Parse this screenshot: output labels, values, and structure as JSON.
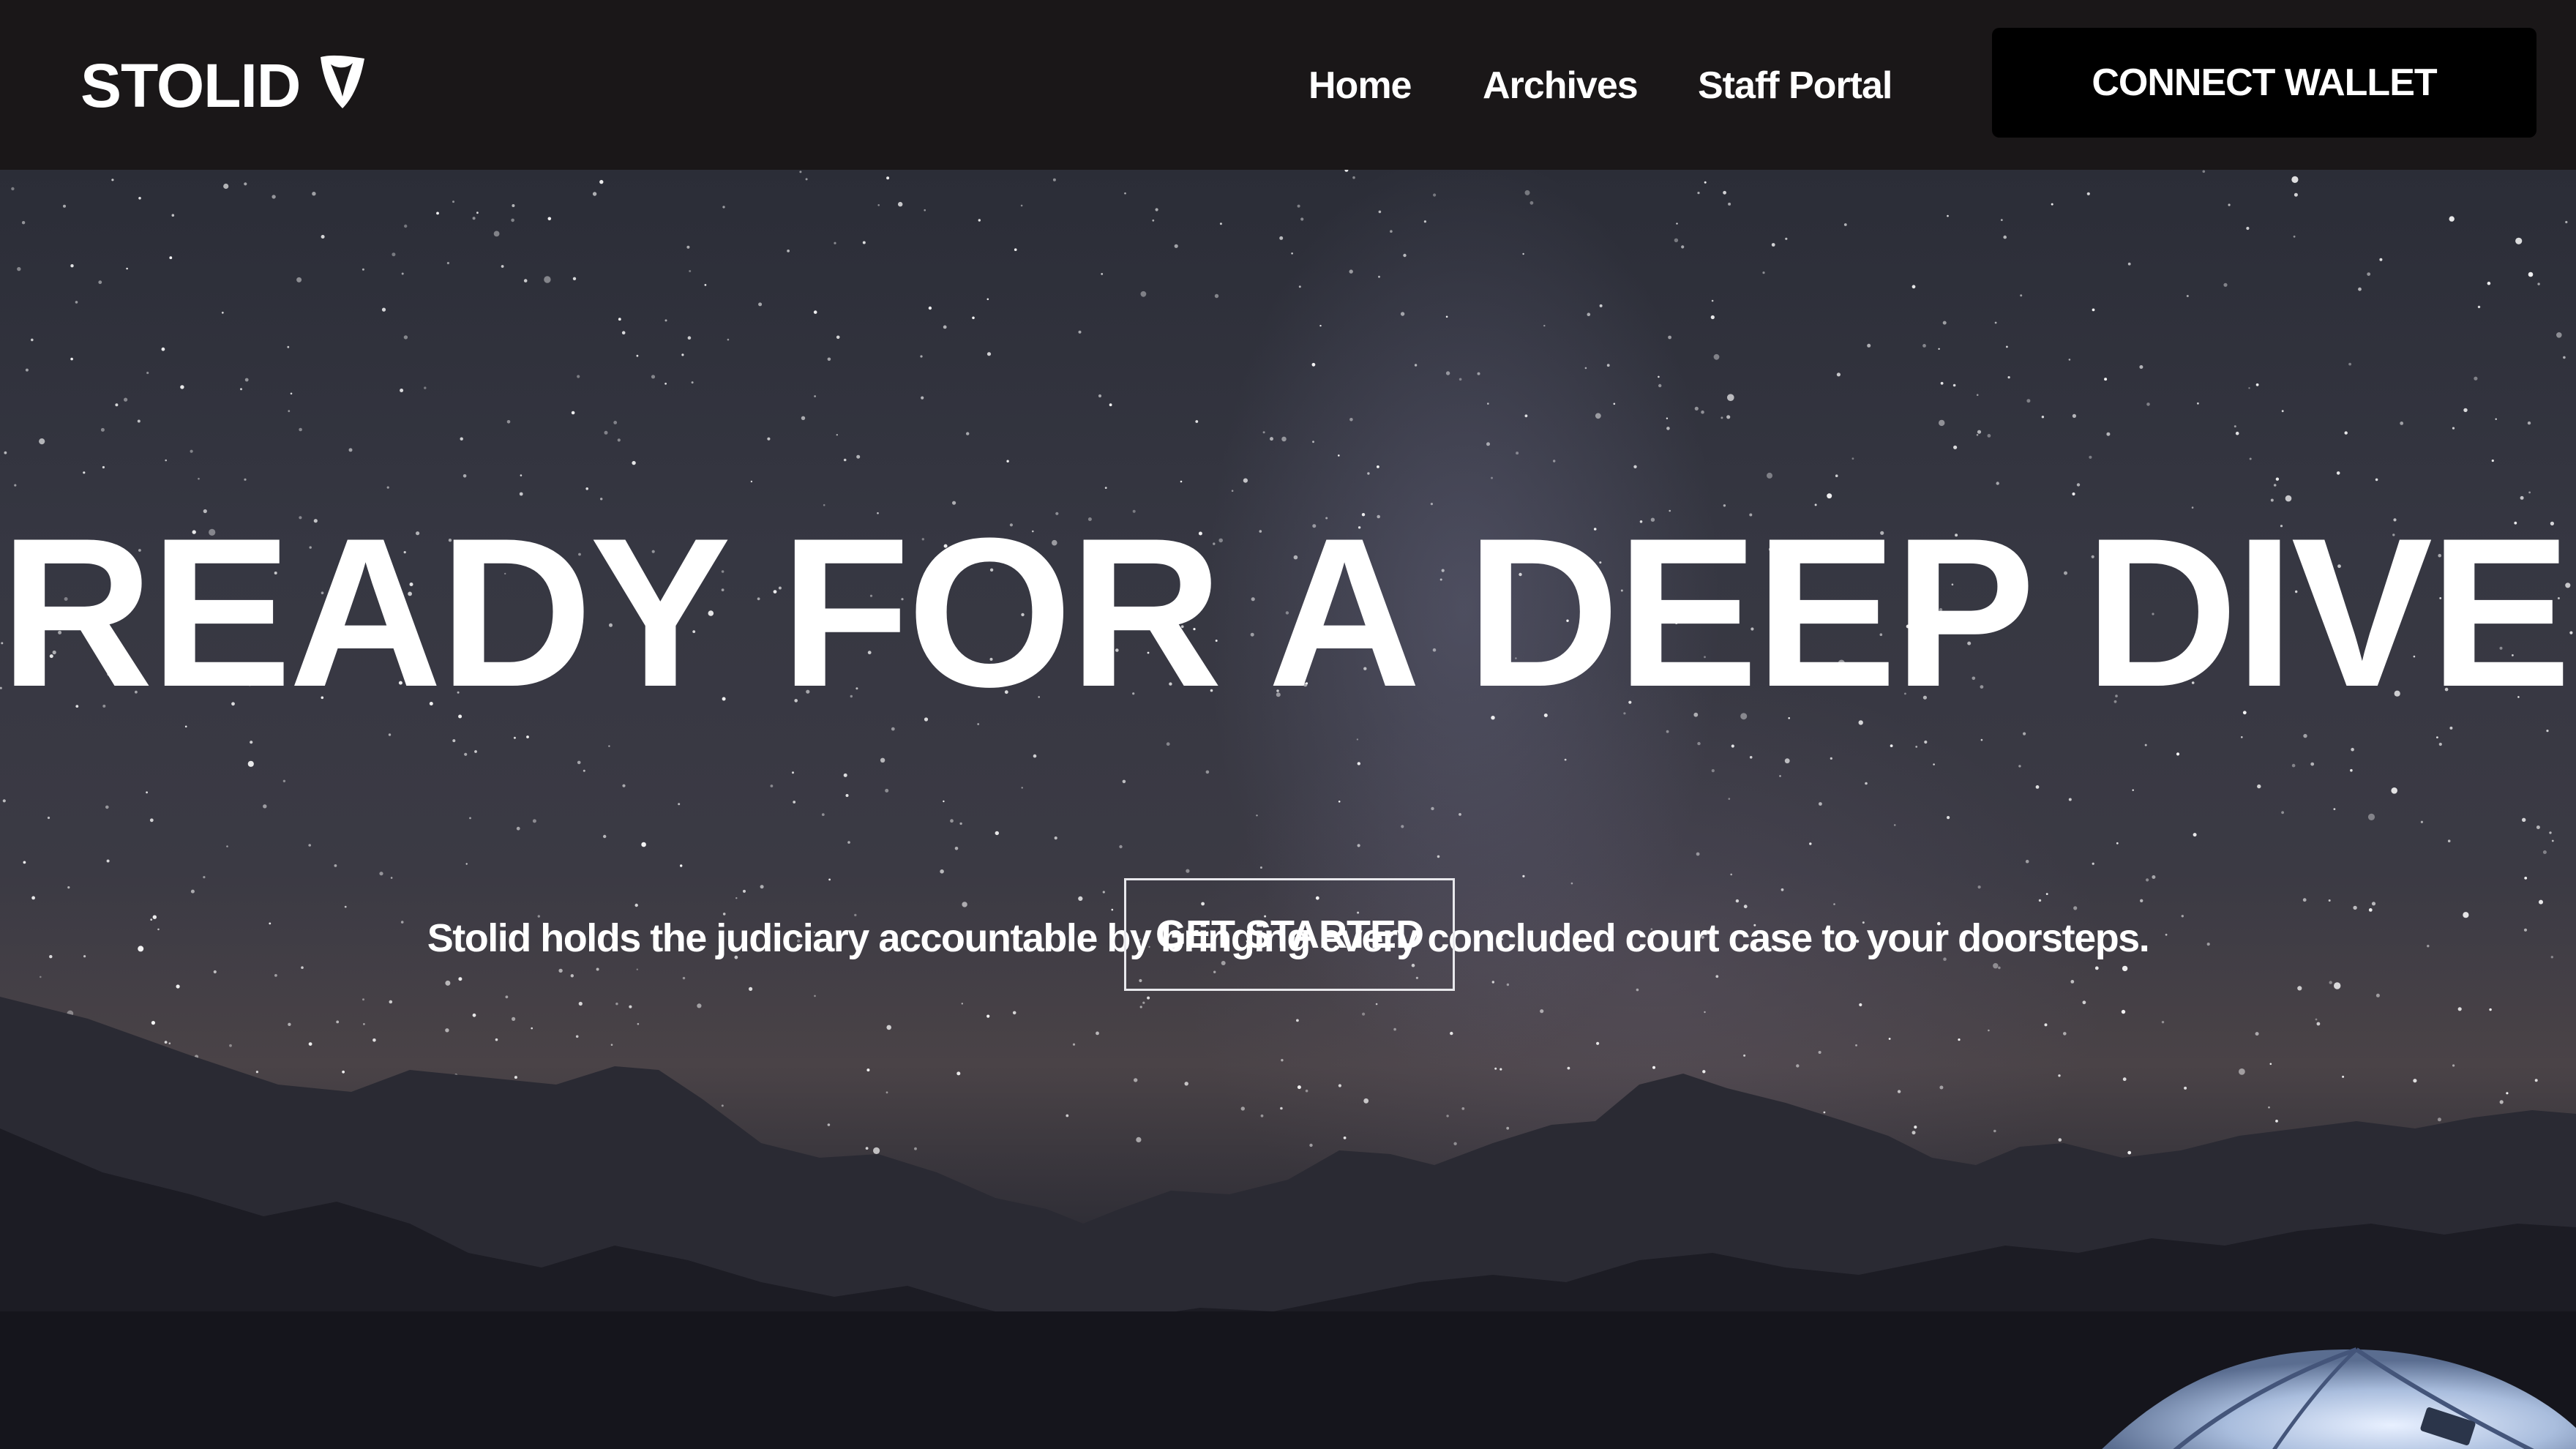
{
  "brand": {
    "name": "STOLID",
    "logo_icon": "stolid-shield-logo"
  },
  "nav": {
    "items": [
      {
        "label": "Home"
      },
      {
        "label": "Archives"
      },
      {
        "label": "Staff Portal"
      }
    ],
    "connect_label": "CONNECT WALLET"
  },
  "hero": {
    "title": "READY FOR A DEEP DIVE?",
    "subtitle": "Stolid holds the judiciary accountable by bringing every concluded court case to your doorsteps.",
    "cta_label": "GET STARTED",
    "background": "starry-night-mountains-image"
  },
  "colors": {
    "navbar_bg": "#1a1718",
    "connect_button_bg": "#000000",
    "text": "#ffffff",
    "cta_border": "#e8e8ec"
  }
}
